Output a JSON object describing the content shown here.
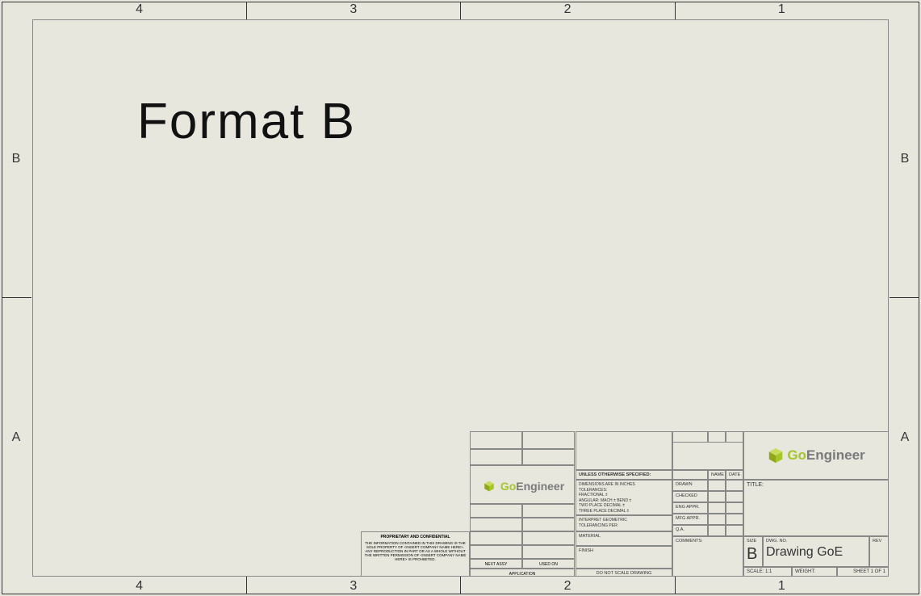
{
  "zones": {
    "cols": [
      "4",
      "3",
      "2",
      "1"
    ],
    "rows": [
      "B",
      "A"
    ]
  },
  "format_title": "Format B",
  "logo": {
    "go": "Go",
    "engineer": "Engineer"
  },
  "proprietary": {
    "heading": "PROPRIETARY AND CONFIDENTIAL",
    "body": "THE INFORMATION CONTAINED IN THIS DRAWING IS THE SOLE PROPERTY OF <INSERT COMPANY NAME HERE>. ANY REPRODUCTION IN PART OR AS A WHOLE WITHOUT THE WRITTEN PERMISSION OF <INSERT COMPANY NAME HERE> IS PROHIBITED."
  },
  "app_grid": {
    "next_assy": "NEXT ASSY",
    "used_on": "USED ON",
    "application": "APPLICATION"
  },
  "tolerances": {
    "unless": "UNLESS OTHERWISE SPECIFIED:",
    "dims": "DIMENSIONS ARE IN INCHES",
    "tol": "TOLERANCES:",
    "frac": "FRACTIONAL ±",
    "ang": "ANGULAR: MACH ±   BEND ±",
    "two": "TWO PLACE DECIMAL   ±",
    "three": "THREE PLACE DECIMAL ±",
    "geo1": "INTERPRET GEOMETRIC",
    "geo2": "TOLERANCING PER:",
    "material": "MATERIAL",
    "finish": "FINISH",
    "noscale": "DO NOT SCALE DRAWING"
  },
  "approvals": {
    "name": "NAME",
    "date": "DATE",
    "drawn": "DRAWN",
    "checked": "CHECKED",
    "eng": "ENG APPR.",
    "mfg": "MFG APPR.",
    "qa": "Q.A.",
    "comments": "COMMENTS:"
  },
  "title_area": {
    "title": "TITLE:",
    "size": "SIZE",
    "size_val": "B",
    "dwgno": "DWG. NO.",
    "dwgno_val": "Drawing GoE",
    "rev": "REV",
    "scale": "SCALE: 1:1",
    "weight": "WEIGHT:",
    "sheet": "SHEET 1 OF 1"
  }
}
